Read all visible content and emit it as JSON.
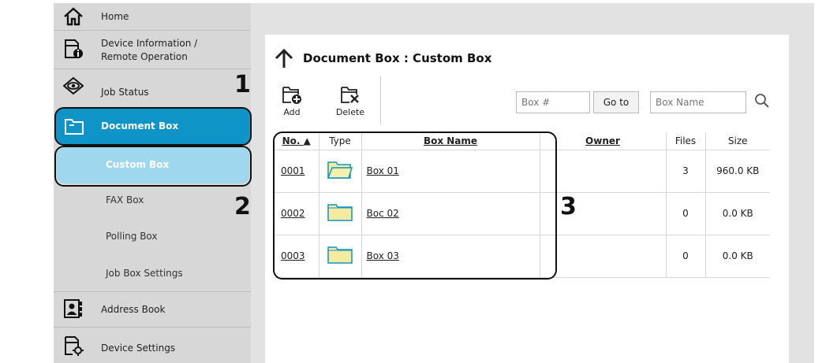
{
  "sidebar": {
    "items": [
      {
        "label": "Home",
        "icon": "home-icon"
      },
      {
        "label": "Device Information /",
        "label2": "Remote Operation",
        "icon": "device-info-icon"
      },
      {
        "label": "Job Status",
        "icon": "eye-icon"
      },
      {
        "label": "Document Box",
        "icon": "folder-icon"
      },
      {
        "label": "Custom Box"
      },
      {
        "label": "FAX Box"
      },
      {
        "label": "Polling Box"
      },
      {
        "label": "Job Box Settings"
      },
      {
        "label": "Address Book",
        "icon": "address-book-icon"
      },
      {
        "label": "Device Settings",
        "icon": "device-settings-icon"
      }
    ]
  },
  "main": {
    "title": "Document Box : Custom Box",
    "toolbar": {
      "add_label": "Add",
      "delete_label": "Delete",
      "box_no_placeholder": "Box #",
      "goto_label": "Go to",
      "box_name_placeholder": "Box Name"
    },
    "table": {
      "headers": {
        "no": "No.",
        "type": "Type",
        "name": "Box Name",
        "owner": "Owner",
        "files": "Files",
        "size": "Size"
      },
      "rows": [
        {
          "no": "0001",
          "name": "Box 01",
          "owner": "",
          "files": "3",
          "size": "960.0 KB",
          "folder": "open"
        },
        {
          "no": "0002",
          "name": "Boc 02",
          "owner": "",
          "files": "0",
          "size": "0.0 KB",
          "folder": "closed"
        },
        {
          "no": "0003",
          "name": "Box 03",
          "owner": "",
          "files": "0",
          "size": "0.0 KB",
          "folder": "closed"
        }
      ]
    }
  },
  "callouts": {
    "one": "1",
    "two": "2",
    "three": "3"
  },
  "colors": {
    "accent": "#0f94c8",
    "accent_light": "#9fd7ee",
    "folder": "#f3ec9e"
  }
}
